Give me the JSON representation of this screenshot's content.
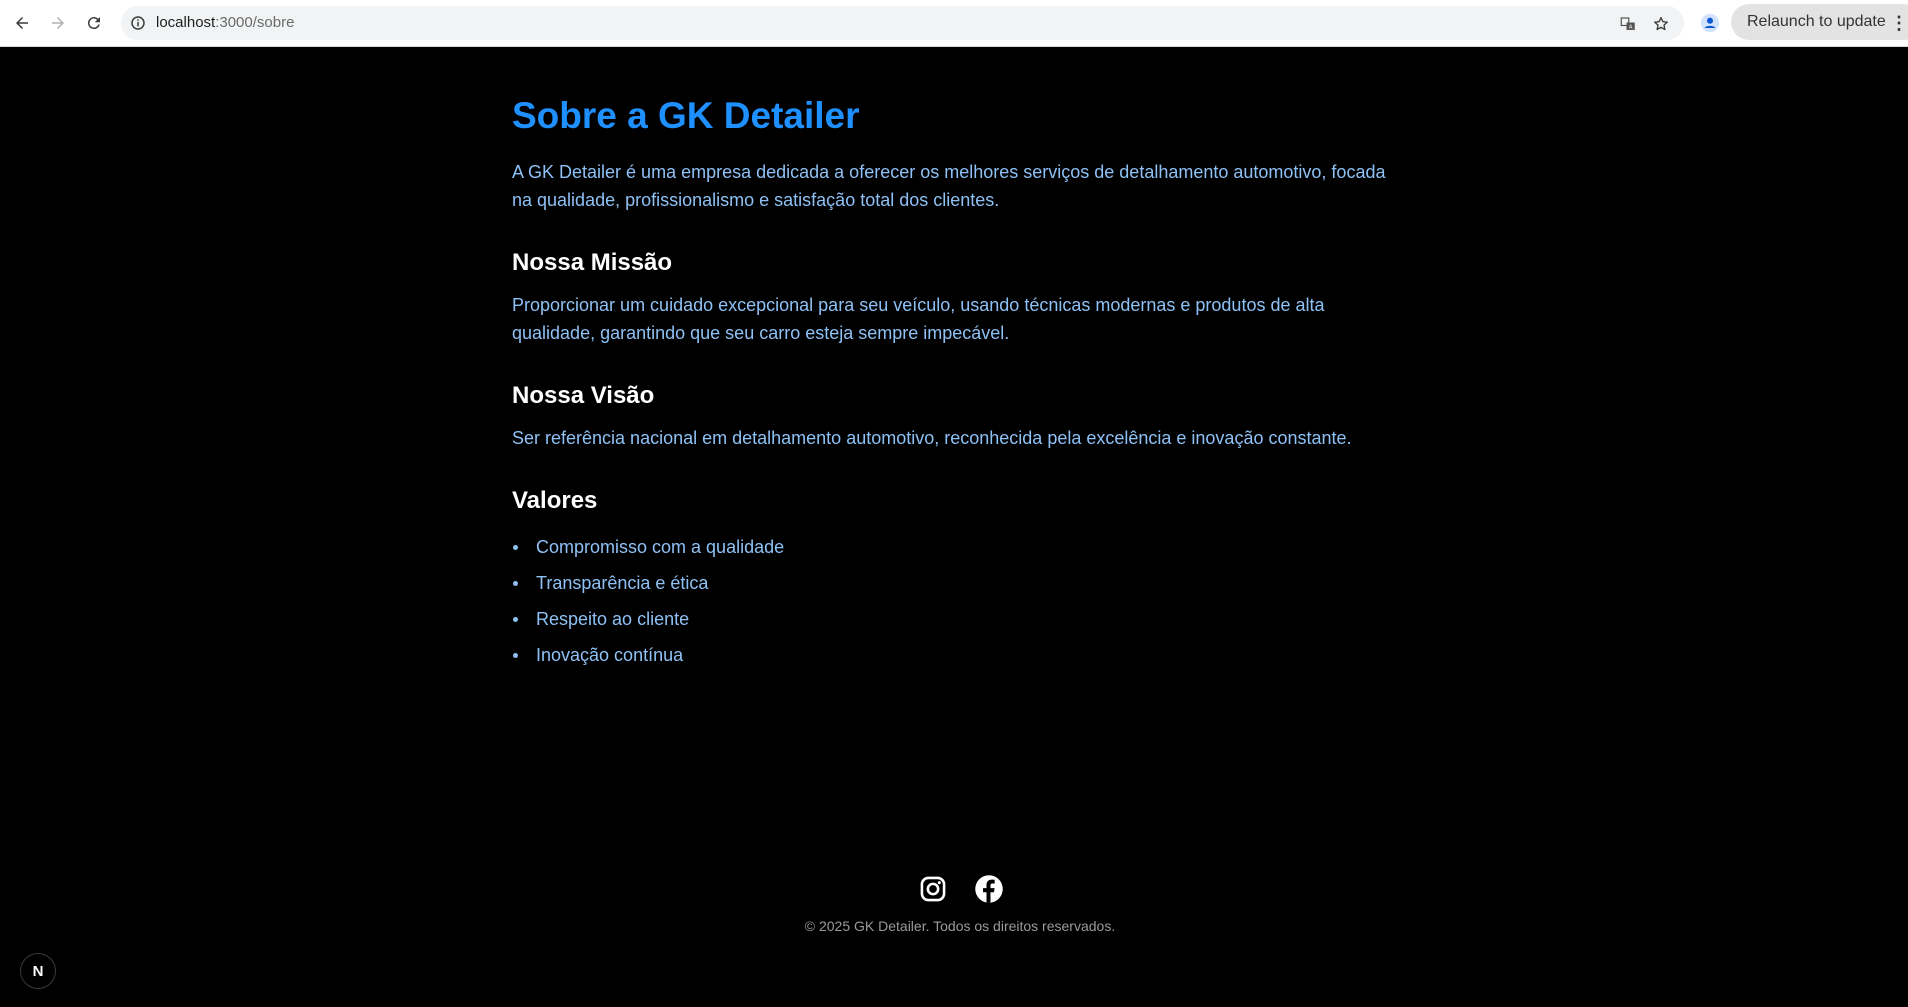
{
  "browser": {
    "url_host": "localhost",
    "url_path": ":3000/sobre",
    "relaunch_label": "Relaunch to update",
    "menu_glyph": "⋮"
  },
  "page": {
    "title": "Sobre a GK Detailer",
    "intro": "A GK Detailer é uma empresa dedicada a oferecer os melhores serviços de detalhamento automotivo, focada na qualidade, profissionalismo e satisfação total dos clientes.",
    "mission": {
      "heading": "Nossa Missão",
      "text": "Proporcionar um cuidado excepcional para seu veículo, usando técnicas modernas e produtos de alta qualidade, garantindo que seu carro esteja sempre impecável."
    },
    "vision": {
      "heading": "Nossa Visão",
      "text": "Ser referência nacional em detalhamento automotivo, reconhecida pela excelência e inovação constante."
    },
    "values": {
      "heading": "Valores",
      "items": [
        "Compromisso com a qualidade",
        "Transparência e ética",
        "Respeito ao cliente",
        "Inovação contínua"
      ]
    }
  },
  "footer": {
    "social_icons": [
      "instagram-icon",
      "facebook-icon"
    ],
    "copyright": "© 2025 GK Detailer. Todos os direitos reservados."
  },
  "dev_badge": {
    "label": "N"
  },
  "colors": {
    "accent": "#1e90ff",
    "body_text": "#8ec1f5",
    "heading": "#ffffff",
    "background": "#000000"
  }
}
